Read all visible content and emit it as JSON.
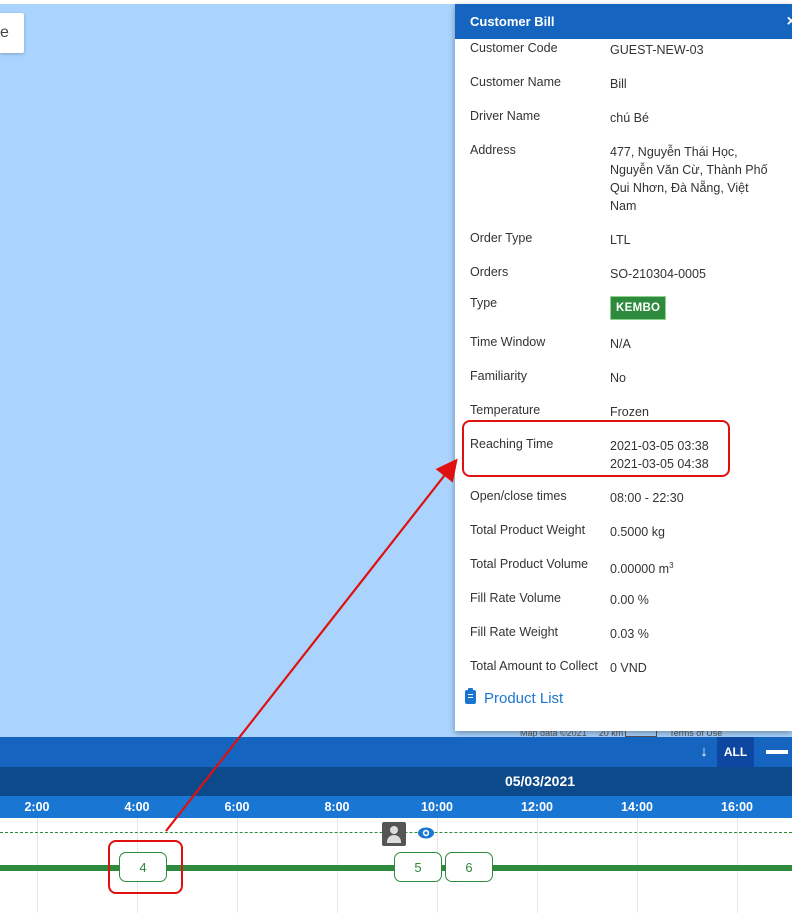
{
  "map": {
    "control_text": "e",
    "attribution": {
      "map_data": "Map data ©2021",
      "scale": "20 km",
      "terms": "Terms of Use"
    }
  },
  "panel": {
    "title": "Customer Bill",
    "close": "×",
    "rows": [
      {
        "label": "Customer Code",
        "value": "GUEST-NEW-03"
      },
      {
        "label": "Customer Name",
        "value": "Bill"
      },
      {
        "label": "Driver Name",
        "value": "chú Bé"
      },
      {
        "label": "Address",
        "value": "477, Nguyễn Thái Học, Nguyễn Văn Cừ, Thành Phố Qui Nhơn, Đà Nẵng, Việt Nam"
      },
      {
        "label": "Order Type",
        "value": "LTL"
      },
      {
        "label": "Orders",
        "value": "SO-210304-0005"
      },
      {
        "label": "Type",
        "value": "KEMBO"
      },
      {
        "label": "Time Window",
        "value": "N/A"
      },
      {
        "label": "Familiarity",
        "value": "No"
      },
      {
        "label": "Temperature",
        "value": "Frozen"
      },
      {
        "label": "Reaching Time",
        "value": "2021-03-05 03:38",
        "value2": "2021-03-05 04:38"
      },
      {
        "label": "Open/close times",
        "value": "08:00 - 22:30"
      },
      {
        "label": "Total Product Weight",
        "value": "0.5000 kg"
      },
      {
        "label": "Total Product Volume",
        "value": "0.00000 m",
        "value_sup": "3"
      },
      {
        "label": "Fill Rate Volume",
        "value": "0.00 %"
      },
      {
        "label": "Fill Rate Weight",
        "value": "0.03 %"
      },
      {
        "label": "Total Amount to Collect",
        "value": "0 VND"
      }
    ],
    "product_list": "Product List"
  },
  "timeline": {
    "all_label": "ALL",
    "date": "05/03/2021",
    "hours": [
      "2:00",
      "4:00",
      "6:00",
      "8:00",
      "10:00",
      "12:00",
      "14:00",
      "16:00"
    ],
    "stops": [
      "4",
      "5",
      "6"
    ]
  },
  "colors": {
    "header": "#1565c0",
    "accent_green": "#2e8b3e",
    "highlight_red": "#e01010",
    "map_water": "#aad3fd"
  }
}
